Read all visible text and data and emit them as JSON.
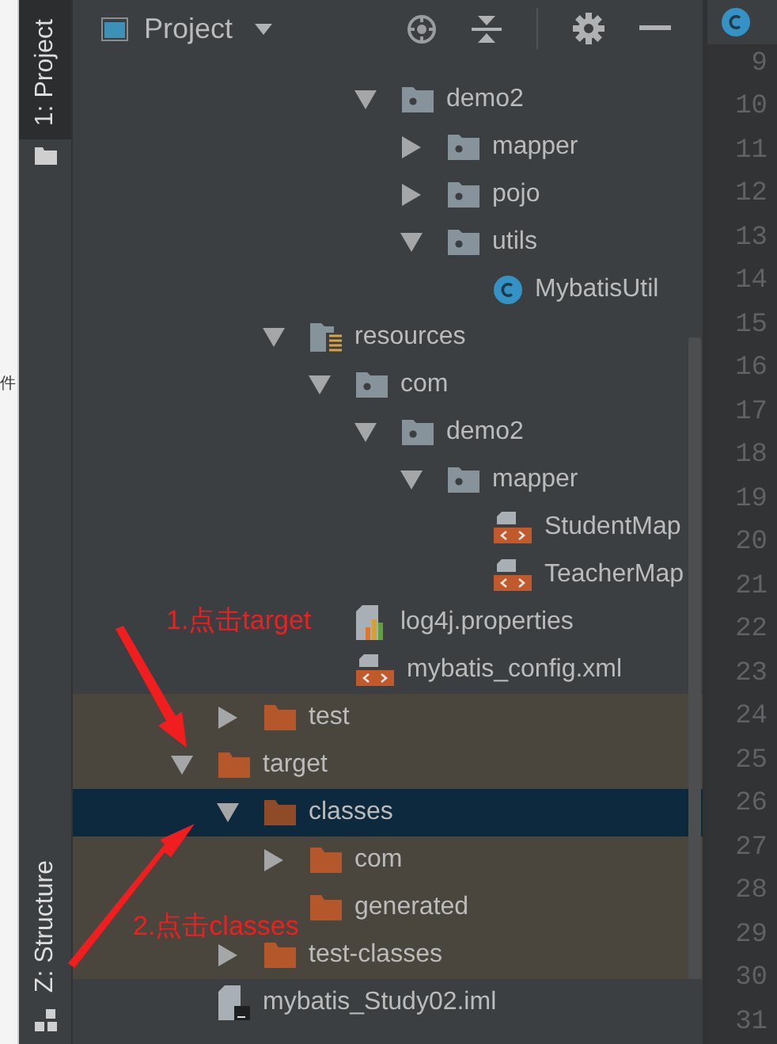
{
  "background_fragment": "件",
  "tool_strip": {
    "top_tab": {
      "label": "1: Project",
      "selected": true
    },
    "bottom_tab": {
      "label": "Z: Structure",
      "selected": false
    }
  },
  "panel": {
    "title": "Project"
  },
  "tree": [
    {
      "children": [
        {
          "children": [
            {
              "children": [
                {
                  "children": [
                    {
                      "label": "demo2",
                      "kind": "package",
                      "expanded": true,
                      "selected": false,
                      "children": [
                        {
                          "label": "mapper",
                          "kind": "package",
                          "expanded": false,
                          "selected": false
                        },
                        {
                          "label": "pojo",
                          "kind": "package",
                          "expanded": false,
                          "selected": false
                        },
                        {
                          "label": "utils",
                          "kind": "package",
                          "expanded": true,
                          "selected": false,
                          "children": [
                            {
                              "label": "MybatisUtil",
                              "kind": "class",
                              "selected": false
                            }
                          ]
                        }
                      ]
                    }
                  ]
                }
              ]
            },
            {
              "label": "resources",
              "kind": "resources",
              "expanded": true,
              "selected": false,
              "children": [
                {
                  "label": "com",
                  "kind": "package",
                  "expanded": true,
                  "selected": false,
                  "children": [
                    {
                      "label": "demo2",
                      "kind": "package",
                      "expanded": true,
                      "selected": false,
                      "children": [
                        {
                          "label": "mapper",
                          "kind": "package",
                          "expanded": true,
                          "selected": false,
                          "children": [
                            {
                              "label": "StudentMap",
                              "kind": "xml",
                              "selected": false
                            },
                            {
                              "label": "TeacherMap",
                              "kind": "xml",
                              "selected": false
                            }
                          ]
                        }
                      ]
                    }
                  ]
                },
                {
                  "label": "log4j.properties",
                  "kind": "properties",
                  "selected": false
                },
                {
                  "label": "mybatis_config.xml",
                  "kind": "xml",
                  "selected": false
                }
              ]
            }
          ]
        },
        {
          "label": "test",
          "kind": "excluded",
          "expanded": false,
          "selected": false
        }
      ]
    },
    {
      "label": "target",
      "kind": "excluded",
      "expanded": true,
      "selected": false,
      "children": [
        {
          "label": "classes",
          "kind": "excluded",
          "expanded": true,
          "selected": true,
          "children": [
            {
              "label": "com",
              "kind": "excluded",
              "expanded": false,
              "selected": false
            },
            {
              "label": "generated",
              "kind": "excluded",
              "selected": false
            }
          ]
        },
        {
          "label": "test-classes",
          "kind": "excluded",
          "expanded": false,
          "selected": false
        }
      ]
    },
    {
      "label": "mybatis_Study02.iml",
      "kind": "iml",
      "selected": false
    }
  ],
  "line_numbers": [
    "9",
    "10",
    "11",
    "12",
    "13",
    "14",
    "15",
    "16",
    "17",
    "18",
    "19",
    "20",
    "21",
    "22",
    "23",
    "24",
    "25",
    "26",
    "27",
    "28",
    "29",
    "30",
    "31"
  ],
  "annotations": [
    {
      "text": "1.点击target"
    },
    {
      "text": "2.点击classes"
    }
  ]
}
